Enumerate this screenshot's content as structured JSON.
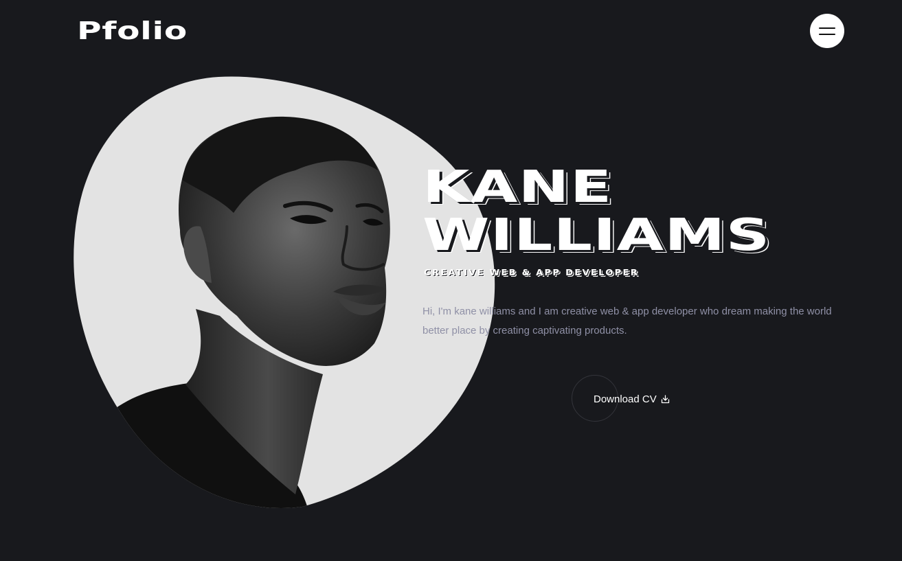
{
  "header": {
    "logo_text": "Pfolio",
    "menu_icon": "hamburger-menu-icon"
  },
  "hero": {
    "name_line1": "KANE",
    "name_line2": "WILLIAMS",
    "role": "CREATIVE WEB & APP DEVELOPER",
    "bio": "Hi, I'm kane williams and I am creative web & app developer who dream making the world better place by creating captivating products.",
    "portrait": "black-and-white portrait photo of Kane Williams",
    "cv_button_label": "Download CV",
    "cv_icon": "download-icon"
  },
  "colors": {
    "background": "#18191d",
    "text": "#ffffff",
    "muted_text": "#8f90a6",
    "blob": "#e3e3e3",
    "menu_button": "#ffffff"
  }
}
